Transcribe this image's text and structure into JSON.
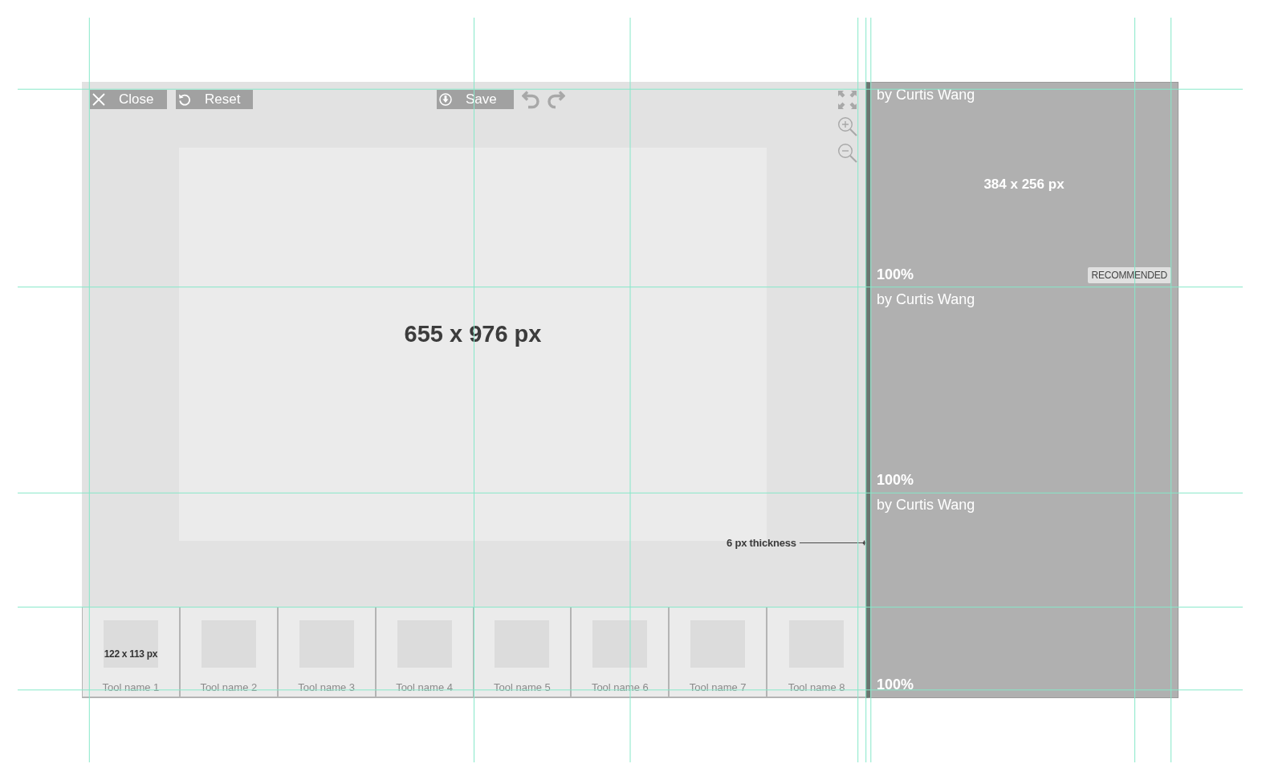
{
  "toolbar": {
    "left_buttons": [
      {
        "kind": "close",
        "label": "Close"
      },
      {
        "kind": "reset",
        "label": "Reset"
      }
    ],
    "center_buttons": [
      {
        "kind": "save",
        "label": "Save"
      }
    ]
  },
  "canvas": {
    "size_label": "655 x 976 px",
    "annotation": "6 px thickness"
  },
  "tools": [
    {
      "name": "Tool name 1",
      "size_label": "122 x 113 px"
    },
    {
      "name": "Tool name 2"
    },
    {
      "name": "Tool name 3"
    },
    {
      "name": "Tool name 4"
    },
    {
      "name": "Tool name 5"
    },
    {
      "name": "Tool name 6"
    },
    {
      "name": "Tool name 7"
    },
    {
      "name": "Tool name 8"
    }
  ],
  "results": [
    {
      "author": "by Curtis Wang",
      "size_label": "384 x 256 px",
      "zoom": "100%",
      "badge": "RECOMMENDED"
    },
    {
      "author": "by Curtis Wang",
      "zoom": "100%"
    },
    {
      "author": "by Curtis Wang",
      "zoom": "100%"
    }
  ]
}
